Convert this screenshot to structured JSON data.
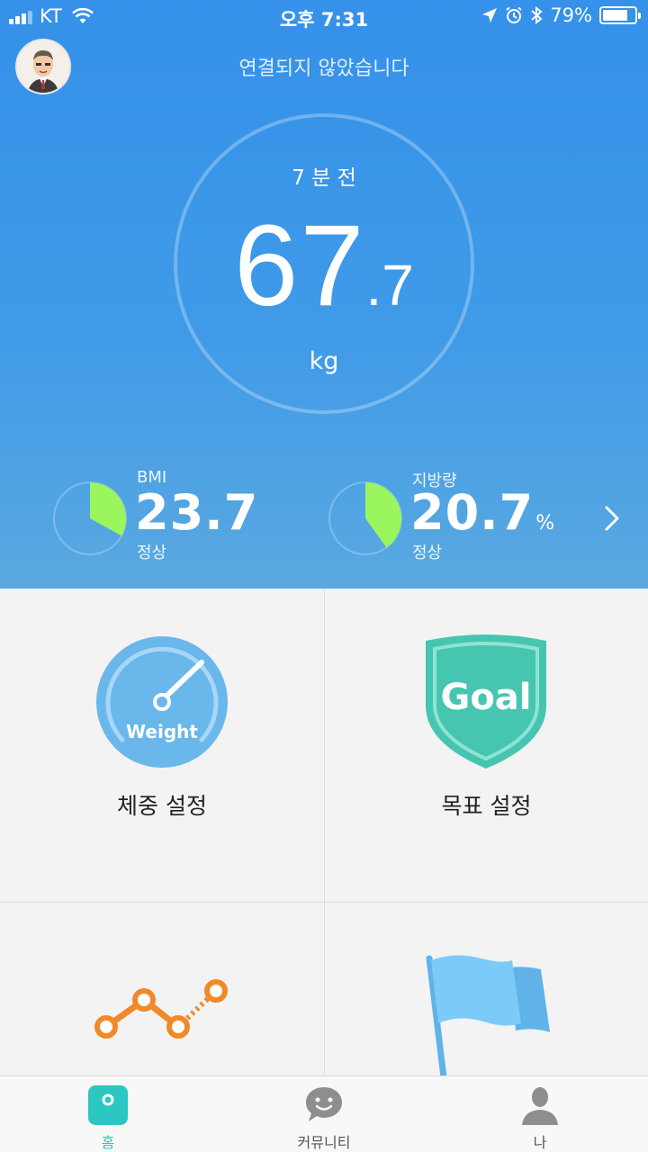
{
  "status_bar": {
    "carrier": "KT",
    "time": "오후 7:31",
    "battery_text": "79%",
    "battery_level": 0.79
  },
  "header": {
    "connection_status": "연결되지 않았습니다"
  },
  "measurement": {
    "time_ago": "7 분 전",
    "weight_whole": "67",
    "weight_decimal": ".7",
    "unit": "kg"
  },
  "metrics": [
    {
      "label": "BMI",
      "value": "23.7",
      "suffix": "",
      "status": "정상",
      "fraction": 0.33,
      "color": "#9bf55c"
    },
    {
      "label": "지방량",
      "value": "20.7",
      "suffix": "%",
      "status": "정상",
      "fraction": 0.4,
      "color": "#9bf55c"
    }
  ],
  "grid": {
    "weight_setting": {
      "label": "체중 설정",
      "icon_text": "Weight",
      "color": "#6ab7ec"
    },
    "goal_setting": {
      "label": "목표 설정",
      "icon_text": "Goal",
      "color": "#46c5b0"
    }
  },
  "tabs": [
    {
      "label": "홈",
      "active": true
    },
    {
      "label": "커뮤니티",
      "active": false
    },
    {
      "label": "나",
      "active": false
    }
  ],
  "colors": {
    "accent": "#2bc7c0",
    "hero_top": "#3591e9",
    "hero_bottom": "#5aa9e0",
    "trend": "#f08a2a",
    "flag": "#7ccaf7"
  }
}
